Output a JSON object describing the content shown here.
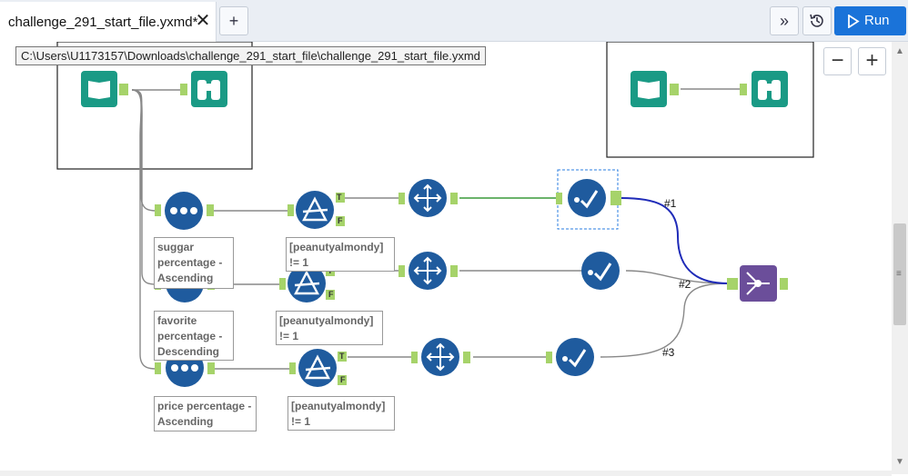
{
  "tab": {
    "title": "challenge_291_start_file.yxmd*",
    "close": "✕",
    "new_tab": "+"
  },
  "toolbar": {
    "expand_icon": "»",
    "history_icon": "history-icon",
    "run_label": "Run",
    "accent": "#1a73d9"
  },
  "tooltip": {
    "path": "C:\\Users\\U1173157\\Downloads\\challenge_291_start_file\\challenge_291_start_file.yxmd"
  },
  "zoom": {
    "minus": "−",
    "plus": "+"
  },
  "colors": {
    "tool_blue": "#1f5b9e",
    "input_green": "#1a9a85",
    "union_purple": "#6b4e9a",
    "anchor": "#a6d36a"
  },
  "annotations": {
    "sort1": "suggar percentage - Ascending",
    "sort2": "favorite percentage - Descending",
    "sort3": "price percentage - Ascending",
    "filter1": "[peanutyalmondy] != 1",
    "filter2": "[peanutyalmondy] != 1",
    "filter3": "[peanutyalmondy] != 1"
  },
  "connections": {
    "c1": "#1",
    "c2": "#2",
    "c3": "#3"
  },
  "anchors": {
    "true": "T",
    "false": "F"
  }
}
